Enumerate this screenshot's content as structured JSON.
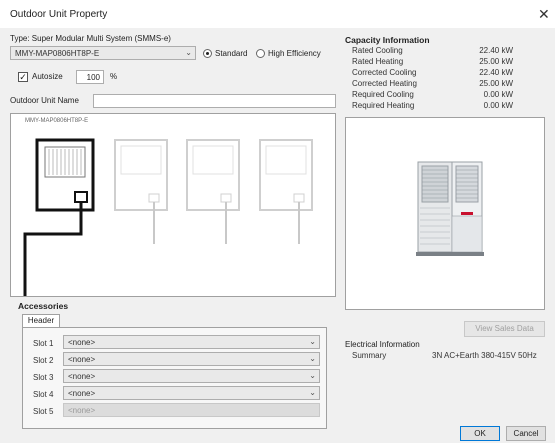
{
  "window": {
    "title": "Outdoor Unit Property"
  },
  "type": {
    "label": "Type: Super Modular Multi System (SMMS-e)",
    "model_value": "MMY-MAP0806HT8P-E",
    "standard_label": "Standard",
    "high_efficiency_label": "High Efficiency",
    "selected": "Standard"
  },
  "autosize": {
    "label": "Autosize",
    "checked": true,
    "percent_value": "100",
    "unit": "%"
  },
  "name_field": {
    "label": "Outdoor Unit Name",
    "value": ""
  },
  "diagram": {
    "unit_model": "MMY-MAP0806HT8P-E"
  },
  "capacity": {
    "title": "Capacity Information",
    "rows": [
      {
        "label": "Rated Cooling",
        "value": "22.40 kW"
      },
      {
        "label": "Rated Heating",
        "value": "25.00 kW"
      },
      {
        "label": "Corrected Cooling",
        "value": "22.40 kW"
      },
      {
        "label": "Corrected Heating",
        "value": "25.00 kW"
      },
      {
        "label": "Required Cooling",
        "value": "0.00 kW"
      },
      {
        "label": "Required Heating",
        "value": "0.00 kW"
      }
    ]
  },
  "view_sales_data_label": "View Sales Data",
  "electrical": {
    "title": "Electrical Information",
    "summary_label": "Summary",
    "summary_value": "3N AC+Earth 380-415V 50Hz"
  },
  "accessories": {
    "title": "Accessories",
    "tab_label": "Header",
    "slots": [
      {
        "label": "Slot 1",
        "value": "<none>"
      },
      {
        "label": "Slot 2",
        "value": "<none>"
      },
      {
        "label": "Slot 3",
        "value": "<none>"
      },
      {
        "label": "Slot 4",
        "value": "<none>"
      },
      {
        "label": "Slot 5",
        "value": "<none>"
      }
    ]
  },
  "buttons": {
    "ok": "OK",
    "cancel": "Cancel"
  }
}
